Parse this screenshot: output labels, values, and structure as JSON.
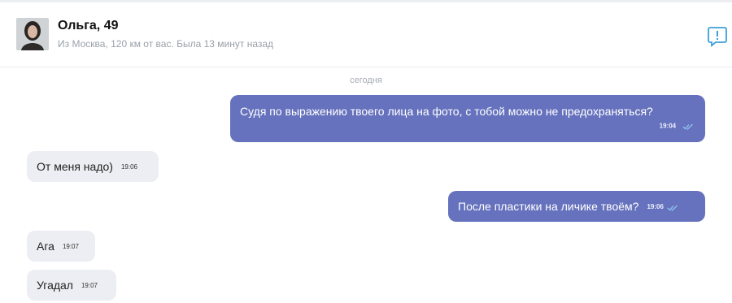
{
  "header": {
    "name": "Ольга, 49",
    "subtitle": "Из Москва, 120 км от вас. Была 13 минут назад"
  },
  "date_divider": "сегодня",
  "messages": [
    {
      "direction": "out",
      "text": "Судя по выражению твоего лица на фото, с тобой можно не предохраняться?",
      "time": "19:04",
      "read": true
    },
    {
      "direction": "in",
      "text": "От меня надо)",
      "time": "19:06"
    },
    {
      "direction": "out",
      "text": "После пластики на личике твоём?",
      "time": "19:06",
      "read": true
    },
    {
      "direction": "in",
      "text": "Ага",
      "time": "19:07"
    },
    {
      "direction": "in",
      "text": "Угадал",
      "time": "19:07"
    }
  ],
  "icons": {
    "report": "report-icon",
    "read_receipt": "double-check-icon"
  },
  "colors": {
    "outgoing_bubble": "#6672bd",
    "incoming_bubble": "#eceef3",
    "accent_icon": "#3aa0d8"
  }
}
